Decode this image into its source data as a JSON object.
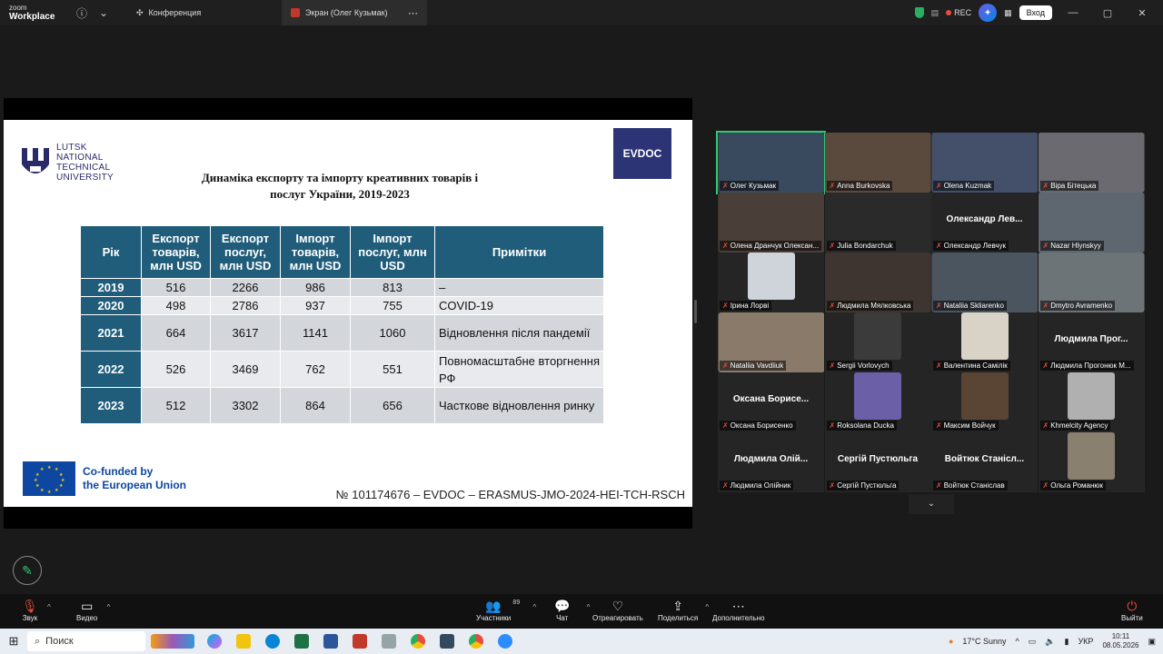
{
  "titlebar": {
    "app_name_top": "zoom",
    "app_name_bottom": "Workplace",
    "tab_conference": "Конференция",
    "tab_screen": "Экран (Олег Кузьмак)",
    "rec_label": "REC",
    "login_label": "Вход"
  },
  "slide": {
    "university_lines": [
      "LUTSK",
      "NATIONAL",
      "TECHNICAL",
      "UNIVERSITY"
    ],
    "title_line1": "Динаміка експорту та імпорту креативних товарів і",
    "title_line2": "послуг України, 2019-2023",
    "evdoc_logo": "EVDOC",
    "table": {
      "headers": [
        "Рік",
        "Експорт товарів, млн USD",
        "Експорт послуг, млн USD",
        "Імпорт товарів, млн USD",
        "Імпорт послуг, млн USD",
        "Примітки"
      ],
      "rows": [
        {
          "year": "2019",
          "exp_goods": "516",
          "exp_serv": "2266",
          "imp_goods": "986",
          "imp_serv": "813",
          "note": "–"
        },
        {
          "year": "2020",
          "exp_goods": "498",
          "exp_serv": "2786",
          "imp_goods": "937",
          "imp_serv": "755",
          "note": "COVID-19"
        },
        {
          "year": "2021",
          "exp_goods": "664",
          "exp_serv": "3617",
          "imp_goods": "1141",
          "imp_serv": "1060",
          "note": "Відновлення після пандемії"
        },
        {
          "year": "2022",
          "exp_goods": "526",
          "exp_serv": "3469",
          "imp_goods": "762",
          "imp_serv": "551",
          "note": "Повномасштабне вторгнення РФ"
        },
        {
          "year": "2023",
          "exp_goods": "512",
          "exp_serv": "3302",
          "imp_goods": "864",
          "imp_serv": "656",
          "note": "Часткове відновлення ринку"
        }
      ]
    },
    "eu_line1": "Co-funded by",
    "eu_line2": "the European Union",
    "project_code": "№ 101174676 – EVDOC – ERASMUS-JMO-2024-HEI-TCH-RSCH"
  },
  "participants": [
    {
      "name": "Олег Кузьмак",
      "big": "",
      "speaker": true
    },
    {
      "name": "Anna Burkovska",
      "big": ""
    },
    {
      "name": "Olena Kuzmak",
      "big": ""
    },
    {
      "name": "Віра Бітецька",
      "big": ""
    },
    {
      "name": "Олена Дранчук Олексан...",
      "big": ""
    },
    {
      "name": "Julia Bondarchuk",
      "big": ""
    },
    {
      "name": "Олександр Левчук",
      "big": "Олександр Лев..."
    },
    {
      "name": "Nazar Hlynskyy",
      "big": ""
    },
    {
      "name": "Ірина Лорві",
      "big": ""
    },
    {
      "name": "Людмила Мялковська",
      "big": ""
    },
    {
      "name": "Nataliia Skliarenko",
      "big": ""
    },
    {
      "name": "Dmytro Avramenko",
      "big": ""
    },
    {
      "name": "Nataliia Vavdiiuk",
      "big": ""
    },
    {
      "name": "Sergii Vorlovych",
      "big": ""
    },
    {
      "name": "Валентина Самілік",
      "big": ""
    },
    {
      "name": "Людмила Прогонюк М...",
      "big": "Людмила Прог..."
    },
    {
      "name": "Оксана Борисенко",
      "big": "Оксана Борисе..."
    },
    {
      "name": "Roksolana Ducka",
      "big": ""
    },
    {
      "name": "Максим Войчук",
      "big": ""
    },
    {
      "name": "Khmelcity Agency",
      "big": ""
    },
    {
      "name": "Людмила Олійник",
      "big": "Людмила Олій..."
    },
    {
      "name": "Сергій Пустюльга",
      "big": "Сергій Пустюльга"
    },
    {
      "name": "Войтюк Станіслав",
      "big": "Войтюк Станісл..."
    },
    {
      "name": "Ольга Романюк",
      "big": ""
    }
  ],
  "toolbar": {
    "audio": "Звук",
    "video": "Видео",
    "participants": "Участники",
    "participants_count": "89",
    "chat": "Чат",
    "react": "Отреагировать",
    "share": "Поделиться",
    "more": "Дополнительно",
    "leave": "Выйти"
  },
  "taskbar": {
    "search_placeholder": "Поиск",
    "weather": "17°C  Sunny",
    "lang": "УКР",
    "time": "10:11",
    "date": "08.05.2026"
  }
}
